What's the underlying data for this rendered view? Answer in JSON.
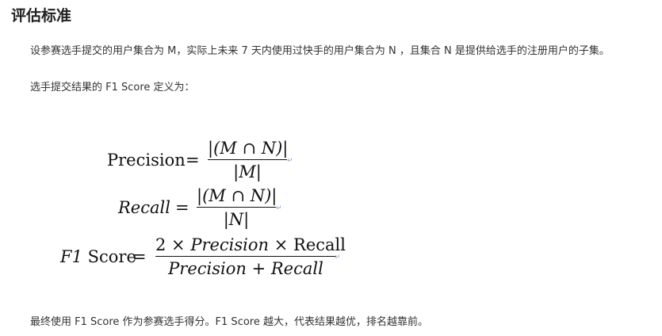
{
  "section": {
    "title": "评估标准"
  },
  "paragraphs": {
    "definition": "设参赛选手提交的用户集合为 M，实际上未来 7 天内使用过快手的用户集合为 N ，且集合 N 是提供给选手的注册用户的子集。",
    "f1_intro": "选手提交结果的 F1 Score 定义为：",
    "conclusion": "最终使用 F1 Score 作为参赛选手得分。F1 Score 越大，代表结果越优，排名越靠前。"
  },
  "formulas": {
    "precision": {
      "lhs": "Precision",
      "equals": "=",
      "numerator": "|(M ∩ N)|",
      "denominator": "|M|"
    },
    "recall": {
      "lhs": "Recall",
      "equals": "=",
      "numerator": "|(M ∩ N)|",
      "denominator": "|N|"
    },
    "f1": {
      "lhs_italic": "F1",
      "lhs_rest": " Score",
      "equals": "=",
      "numerator_a": "2 × ",
      "numerator_b": "Precision",
      "numerator_c": " × Recall",
      "denominator": "Precision + Recall"
    },
    "line_end_mark": "↵"
  }
}
